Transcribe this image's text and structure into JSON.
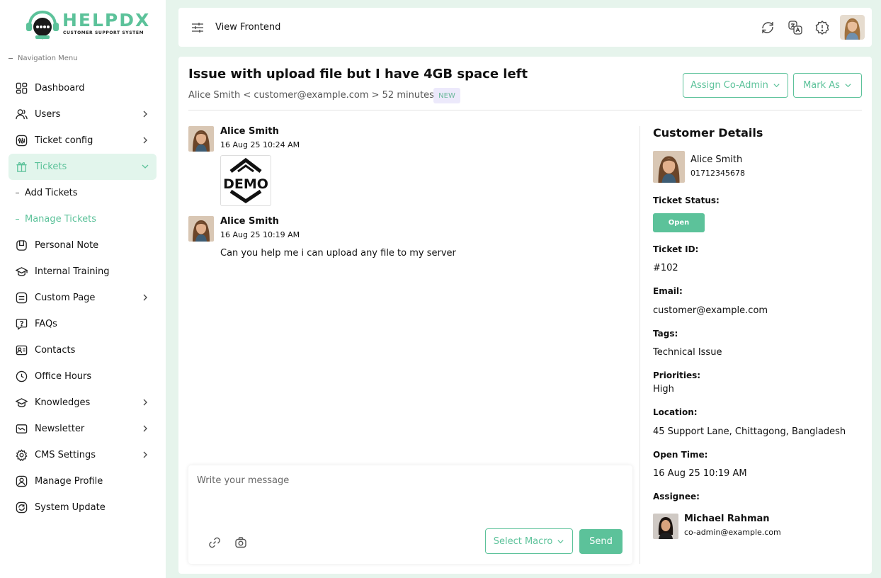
{
  "brand": {
    "name": "HELPDX",
    "tagline": "CUSTOMER SUPPORT SYSTEM",
    "accent": "#5cc29a"
  },
  "sidebar": {
    "heading": "Navigation Menu",
    "items": [
      {
        "label": "Dashboard",
        "icon": "dashboard-icon"
      },
      {
        "label": "Users",
        "icon": "users-icon"
      },
      {
        "label": "Ticket config",
        "icon": "ticket-config-icon"
      },
      {
        "label": "Tickets",
        "icon": "tickets-icon"
      },
      {
        "label": "Personal Note",
        "icon": "note-icon"
      },
      {
        "label": "Internal Training",
        "icon": "graduation-cap-icon"
      },
      {
        "label": "Custom Page",
        "icon": "page-icon"
      },
      {
        "label": "FAQs",
        "icon": "faq-icon"
      },
      {
        "label": "Contacts",
        "icon": "contacts-icon"
      },
      {
        "label": "Office Hours",
        "icon": "clock-icon"
      },
      {
        "label": "Knowledges",
        "icon": "knowledge-icon"
      },
      {
        "label": "Newsletter",
        "icon": "newsletter-icon"
      },
      {
        "label": "CMS Settings",
        "icon": "gear-icon"
      },
      {
        "label": "Manage Profile",
        "icon": "profile-icon"
      },
      {
        "label": "System Update",
        "icon": "update-icon"
      }
    ],
    "tickets_sub": [
      {
        "label": "Add Tickets"
      },
      {
        "label": "Manage Tickets"
      }
    ]
  },
  "topbar": {
    "view_frontend": "View Frontend",
    "icons": [
      "refresh-icon",
      "translate-icon",
      "alert-icon"
    ]
  },
  "ticket": {
    "title": "Issue with upload file but I have 4GB space left",
    "meta": "Alice Smith < customer@example.com > 52 minutes ago",
    "badge": "NEW",
    "assign_label": "Assign Co-Admin",
    "mark_label": "Mark As"
  },
  "messages": [
    {
      "name": "Alice Smith",
      "time": "16 Aug 25 10:24 AM",
      "attachment": "DEMO"
    },
    {
      "name": "Alice Smith",
      "time": "16 Aug 25 10:19 AM",
      "text": "Can you help me i can upload any file to my server"
    }
  ],
  "compose": {
    "placeholder": "Write your message",
    "macro_label": "Select Macro",
    "send_label": "Send"
  },
  "customer": {
    "heading": "Customer Details",
    "name": "Alice Smith",
    "phone": "01712345678",
    "status_label": "Ticket Status:",
    "status_value": "Open",
    "id_label": "Ticket ID:",
    "id_value": "#102",
    "email_label": "Email:",
    "email_value": "customer@example.com",
    "tags_label": "Tags:",
    "tags_value": "Technical Issue",
    "priority_label": "Priorities:",
    "priority_value": "High",
    "location_label": "Location:",
    "location_value": "45 Support Lane, Chittagong, Bangladesh",
    "open_label": "Open Time:",
    "open_value": "16 Aug 25 10:19 AM",
    "assignee_label": "Assignee:",
    "assignee_name": "Michael Rahman",
    "assignee_email": "co-admin@example.com"
  }
}
